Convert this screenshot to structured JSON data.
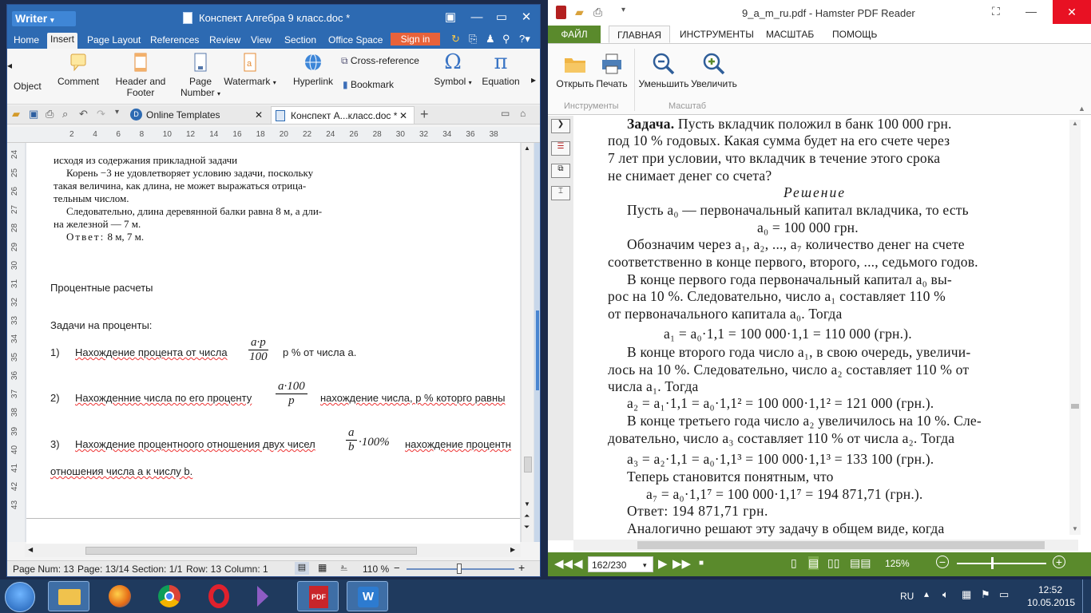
{
  "writer": {
    "app_name": "Writer",
    "title": "Конспект Алгебра 9 класс.doc *",
    "menu": [
      "Home",
      "Insert",
      "Page Layout",
      "References",
      "Review",
      "View",
      "Section",
      "Office Space"
    ],
    "active_menu": "Insert",
    "signin": "Sign in",
    "ribbon": {
      "object": "Object",
      "comment": "Comment",
      "header_footer_1": "Header and",
      "header_footer_2": "Footer",
      "page_number_1": "Page",
      "page_number_2": "Number",
      "watermark": "Watermark",
      "hyperlink": "Hyperlink",
      "cross_reference": "Cross-reference",
      "bookmark": "Bookmark",
      "symbol": "Symbol",
      "equation": "Equation",
      "symbol_glyph": "Ω",
      "equation_glyph": "π"
    },
    "tabs": {
      "online_templates": "Online Templates",
      "doc_tab": "Конспект А...класс.doc *"
    },
    "ruler_numbers": [
      "2",
      "4",
      "6",
      "8",
      "10",
      "12",
      "14",
      "16",
      "18",
      "20",
      "22",
      "24",
      "26",
      "28",
      "30",
      "32",
      "34",
      "36",
      "38"
    ],
    "line_numbers": [
      "24",
      "25",
      "26",
      "27",
      "28",
      "29",
      "30",
      "31",
      "32",
      "33",
      "34",
      "35",
      "36",
      "37",
      "38",
      "39",
      "40",
      "41",
      "42",
      "43"
    ],
    "book": {
      "line0": "исходя из содержания прикладной задачи",
      "line1": "Корень −3 не удовлетворяет условию задачи, поскольку",
      "line2": "такая величина, как длина, не может выражаться отрица-",
      "line3": "тельным числом.",
      "line4": "Следовательно, длина деревянной балки равна 8 м, а дли-",
      "line5": "на железной — 7 м.",
      "answer_label": "Ответ:",
      "answer_value": "8 м, 7 м."
    },
    "content": {
      "heading": "Процентные расчеты",
      "subheading": "Задачи на проценты:",
      "item1_num": "1)",
      "item1_text": "Нахождение процента от числа",
      "item1_frac_num": "a·p",
      "item1_frac_den": "100",
      "item1_tail": "р % от числа а.",
      "item2_num": "2)",
      "item2_text": "Нахожденние числа по его проценту",
      "item2_frac_num": "a·100",
      "item2_frac_den": "p",
      "item2_tail": "нахождение числа, р % которго равны",
      "item3_num": "3)",
      "item3_text": "Нахождение процентноого отношения двух чисел",
      "item3_frac_num": "a",
      "item3_frac_den": "b",
      "item3_mult": "·100%",
      "item3_tail": "нахождение процентн",
      "item3_cont": "отношения числа а к числу b."
    },
    "status": {
      "page_num": "Page Num: 13",
      "page": "Page: 13/14",
      "section": "Section: 1/1",
      "row": "Row: 13",
      "column": "Column: 1",
      "zoom": "110 %"
    }
  },
  "pdf": {
    "title": "9_a_m_ru.pdf - Hamster PDF Reader",
    "menu": [
      "ФАЙЛ",
      "ГЛАВНАЯ",
      "ИНСТРУМЕНТЫ",
      "МАСШТАБ",
      "ПОМОЩЬ"
    ],
    "active_menu": "ГЛАВНАЯ",
    "ribbon": {
      "open": "Открыть",
      "print": "Печать",
      "zoom_out": "Уменьшить",
      "zoom_in": "Увеличить",
      "group_tools": "Инструменты",
      "group_zoom": "Масштаб"
    },
    "page_indicator": "162/230",
    "zoom": "125%",
    "text": {
      "l1a": "Задача.",
      "l1b": " Пусть вкладчик положил в банк 100 000 грн.",
      "l2": "под 10 % годовых. Какая сумма будет на его счете через",
      "l3": "7 лет при условии, что вкладчик в течение этого срока",
      "l4": "не снимает денег со счета?",
      "solution": "Решение",
      "l5": "Пусть a₀ — первоначальный капитал вкладчика, то есть",
      "l6": "a₀ = 100 000 грн.",
      "l7": "Обозначим через a₁, a₂, ..., a₇ количество денег на счете",
      "l8": "соответственно в конце первого, второго, ..., седьмого годов.",
      "l9": "В конце первого года первоначальный капитал a₀ вы-",
      "l10": "рос на 10 %. Следовательно, число a₁ составляет 110 %",
      "l11": "от первоначального капитала a₀. Тогда",
      "l12": "a₁ = a₀·1,1 = 100 000·1,1 = 110 000 (грн.).",
      "l13": "В конце второго года число a₁, в свою очередь, увеличи-",
      "l14": "лось на 10 %. Следовательно, число a₂ составляет 110 % от",
      "l15": "числа a₁. Тогда",
      "l16": "a₂ = a₁·1,1 = a₀·1,1² = 100 000·1,1² = 121 000 (грн.).",
      "l17": "В конце третьего года число a₂ увеличилось на 10 %. Сле-",
      "l18": "довательно, число a₃ составляет 110 % от числа a₂. Тогда",
      "l19": "a₃ = a₂·1,1 = a₀·1,1³ = 100 000·1,1³ = 133 100 (грн.).",
      "l20": "Теперь становится понятным, что",
      "l21": "a₇ = a₀·1,1⁷ = 100 000·1,1⁷ = 194 871,71 (грн.).",
      "answer": "Ответ: 194 871,71 грн.",
      "l22": "Аналогично решают эту задачу в общем виде, когда"
    }
  },
  "taskbar": {
    "lang": "RU",
    "time": "12:52",
    "date": "10.05.2015"
  },
  "colors": {
    "writer_blue": "#2d6ab2",
    "pdf_green": "#5a8a2c",
    "signin_orange": "#e8623a",
    "taskbar": "#1f3a5e"
  }
}
